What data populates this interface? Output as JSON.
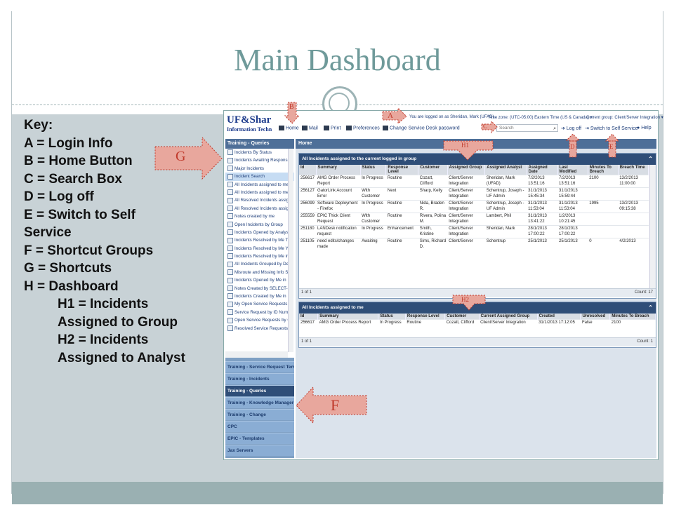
{
  "slide": {
    "title": "Main Dashboard"
  },
  "key": {
    "heading": "Key:",
    "lines": [
      "A = Login Info",
      "B = Home Button",
      "C = Search Box",
      "D = Log off",
      "E = Switch to Self",
      "Service",
      "F = Shortcut Groups",
      "G = Shortcuts",
      "H = Dashboard"
    ],
    "sub_lines": [
      "H1 = Incidents",
      "Assigned to Group",
      "H2 = Incidents",
      "Assigned to Analyst"
    ]
  },
  "callouts": {
    "a": "A",
    "b": "B",
    "c": "C",
    "d": "D",
    "e": "E",
    "f": "F",
    "g": "G",
    "h1": "H1",
    "h2": "H2"
  },
  "app": {
    "logo_main": "UF&Shar",
    "logo_sub": "Information Techn",
    "toolbar": {
      "home": "Home",
      "mail": "Mail",
      "print": "Print",
      "preferences": "Preferences",
      "change_desk": "Change Service Desk password",
      "log_off": "Log off",
      "switch_self": "Switch to Self Service",
      "help": "Help"
    },
    "login_info": "You are logged on as Sheridan, Mark (UFAD)",
    "timezone": "Time zone: (UTC-05:00) Eastern Time (US & Canada) ▾",
    "current_group": "Current group: Client/Server Integration ▾",
    "search_placeholder": "Search",
    "sidebar": {
      "header": "Training - Queries",
      "items": [
        "Incidents By Status",
        "Incidents Awaiting Respons",
        "Major Incidents",
        "Incident Search",
        "All Incidents assigned to me",
        "All Incidents assigned to me",
        "All Resolved Incidents assig",
        "All Resolved Incidents assig",
        "Notes created by me",
        "Open Incidents by Group",
        "Incidents Opened by Analys",
        "Incidents Resolved by Me T",
        "Incidents Resolved by Me Y",
        "Incidents Resolved by Me in",
        "All Incidents Grouped by De",
        "Misroute and Missing Info S",
        "Incidents Opened by Me in",
        "Notes Created by SELECT-",
        "Incidents Created by Me in",
        "My Open Service Requests",
        "Service Request by ID Num",
        "Open Service Requests by G",
        "Resolved Service Requests"
      ],
      "selected_index": 3,
      "groups": [
        "Training - Service Request Tem",
        "Training - Incidents",
        "Training - Queries",
        "Training - Knowledge Manager",
        "Training - Change",
        "CPC",
        "EPIC - Templates",
        "Jax Servers"
      ],
      "active_group_index": 2
    },
    "main_header": "Home",
    "panel1": {
      "title": "All Incidents assigned to the current logged in group",
      "columns": [
        "Id",
        "Summary",
        "Status",
        "Response Level",
        "Customer",
        "Assigned Group",
        "Assigned Analyst",
        "Assigned Date",
        "Last Modified",
        "Minutes To Breach",
        "Breach Time"
      ],
      "rows": [
        [
          "256617",
          "AMG Order Process Report",
          "In Progress",
          "Routine",
          "Cozatt, Clifford",
          "Client/Server Integration",
          "Sheridan, Mark (UFAD)",
          "7/2/2013 13:51:16",
          "7/2/2013 13:51:16",
          "2100",
          "13/2/2013 11:00:00"
        ],
        [
          "256127",
          "GatorLink Account Error",
          "With Customer",
          "Next",
          "Sharp, Kelly",
          "Client/Server Integration",
          "Schentrup, Joseph - UF Admin",
          "31/1/2013 15:45:34",
          "31/1/2013 15:59:44",
          "",
          ""
        ],
        [
          "256099",
          "Software Deployment - Firefox",
          "In Progress",
          "Routine",
          "Nida, Braden R.",
          "Client/Server Integration",
          "Schentrup, Joseph - UF Admin",
          "31/1/2013 11:53:04",
          "31/1/2013 11:53:04",
          "1995",
          "13/2/2013 09:15:38"
        ],
        [
          "255559",
          "EPIC Thick Client Request",
          "With Customer",
          "Routine",
          "Rivera, Polina M.",
          "Client/Server Integration",
          "Lambert, Phil",
          "31/1/2013 13:41:22",
          "1/2/2013 10:21:45",
          "",
          ""
        ],
        [
          "251180",
          "LANDesk notification request",
          "In Progress",
          "Enhancement",
          "Smith, Kristine",
          "Client/Server Integration",
          "Sheridan, Mark",
          "28/1/2013 17:00:22",
          "28/1/2013 17:00:22",
          "",
          ""
        ],
        [
          "251105",
          "need edits/changes made",
          "Awaiting",
          "Routine",
          "Sims, Richard D.",
          "Client/Server",
          "Schentrup",
          "25/1/2013",
          "25/1/2013",
          "0",
          "4/2/2013"
        ]
      ],
      "pager": "1 of 1",
      "count": "Count: 17"
    },
    "panel2": {
      "title": "All Incidents assigned to me",
      "columns": [
        "Id",
        "Summary",
        "Status",
        "Response Level",
        "Customer",
        "Current Assigned Group",
        "Created",
        "Unresolved",
        "Minutes To Breach"
      ],
      "rows": [
        [
          "256617",
          "AMG Order Process Report",
          "In Progress",
          "Routine",
          "Cozatt, Clifford",
          "Client/Server Integration",
          "31/1/2013 17:12:05",
          "False",
          "2100"
        ]
      ],
      "pager": "1 of 1",
      "count": "Count: 1"
    }
  },
  "colors": {
    "title": "#6f9a9a",
    "callout_fill": "#e8a79d",
    "callout_border": "#c0392b",
    "header_blue": "#2f4e78"
  }
}
